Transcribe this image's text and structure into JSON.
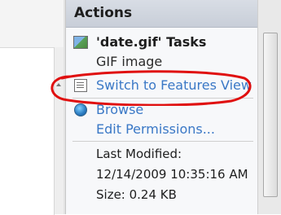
{
  "actions": {
    "title": "Actions",
    "section_title": "'date.gif' Tasks",
    "subtitle": "GIF image",
    "links": {
      "features_view": "Switch to Features View",
      "browse": "Browse",
      "edit_permissions": "Edit Permissions..."
    },
    "info": {
      "last_modified_label": "Last Modified:",
      "last_modified_value": "12/14/2009 10:35:16 AM",
      "size": "Size: 0.24 KB"
    }
  },
  "icons": {
    "section": "gif-file-icon",
    "features_view": "features-view-icon",
    "browse": "browse-globe-icon"
  },
  "colors": {
    "link": "#3a78c6",
    "annotation": "#e01010",
    "header": "#cfd5de"
  }
}
